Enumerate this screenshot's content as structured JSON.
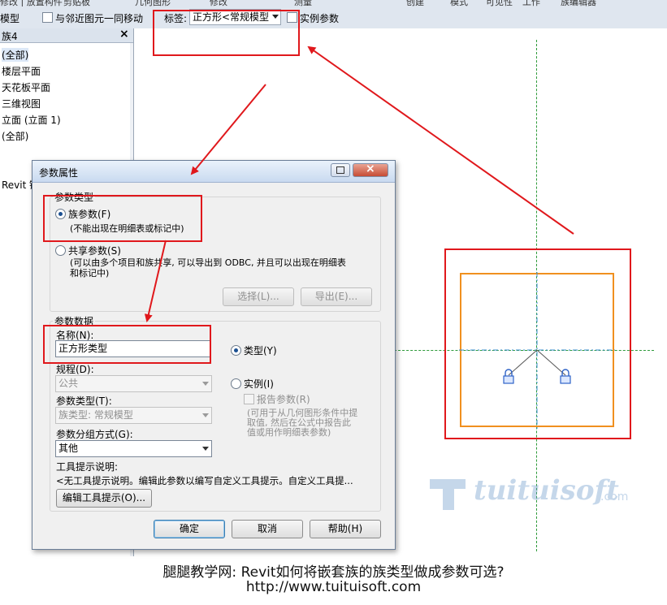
{
  "ribbon": {
    "tabs": [
      "修改 | 放置构件",
      "剪贴板",
      "几何图形",
      "修改",
      "测量",
      "创建",
      "模式",
      "可见性",
      "工作",
      "族编辑器"
    ]
  },
  "options_bar": {
    "mode_label": "模型",
    "move_with_nearby": "与邻近图元一同移动",
    "label_caption": "标签:",
    "label_value": "正方形<常规模型",
    "instance_param": "实例参数"
  },
  "project_browser": {
    "title": "族4",
    "items": [
      "(全部)",
      "楼层平面",
      "天花板平面",
      "三维视图",
      "立面 (立面 1)",
      "(全部)",
      "Revit 链接"
    ]
  },
  "dialog": {
    "title": "参数属性",
    "param_type_group": "参数类型",
    "family_param": "族参数(F)",
    "family_param_hint": "(不能出现在明细表或标记中)",
    "shared_param": "共享参数(S)",
    "shared_param_hint_1": "(可以由多个项目和族共享, 可以导出到 ODBC, 并且可以出现在明细表",
    "shared_param_hint_2": "和标记中)",
    "select_button": "选择(L)...",
    "export_button": "导出(E)...",
    "param_data_group": "参数数据",
    "name_label": "名称(N):",
    "name_value": "正方形类型",
    "type_radio": "类型(Y)",
    "instance_radio": "实例(I)",
    "discipline_label": "规程(D):",
    "discipline_value": "公共",
    "reporting_param": "报告参数(R)",
    "reporting_hint_1": "(可用于从几何图形条件中提",
    "reporting_hint_2": "取值, 然后在公式中报告此",
    "reporting_hint_3": "值或用作明细表参数)",
    "param_type_label": "参数类型(T):",
    "param_type_value": "族类型: 常规模型",
    "group_label": "参数分组方式(G):",
    "group_value": "其他",
    "tooltip_label": "工具提示说明:",
    "tooltip_text": "<无工具提示说明。编辑此参数以编写自定义工具提示。自定义工具提...",
    "edit_tooltip_button": "编辑工具提示(O)...",
    "ok_button": "确定",
    "cancel_button": "取消",
    "help_button": "帮助(H)"
  },
  "watermark": {
    "text": "tuituisoft",
    "suffix": ".com"
  },
  "footer": {
    "caption": "腿腿教学网: Revit如何将嵌套族的族类型做成参数可选?",
    "url": "http://www.tuituisoft.com"
  },
  "colors": {
    "annotation_red": "#e0181c",
    "reference_green": "#2e9a3a",
    "family_orange": "#f0901f",
    "lock_blue": "#2f63c7"
  }
}
